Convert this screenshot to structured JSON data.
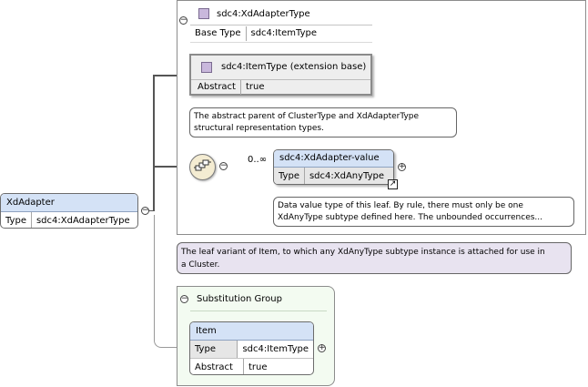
{
  "root": {
    "name": "XdAdapter",
    "type_label": "Type",
    "type_value": "sdc4:XdAdapterType"
  },
  "complex_type": {
    "name": "sdc4:XdAdapterType",
    "base_label": "Base Type",
    "base_value": "sdc4:ItemType"
  },
  "extension": {
    "name": "sdc4:ItemType (extension base)",
    "abstract_label": "Abstract",
    "abstract_value": "true"
  },
  "extension_note": [
    "The abstract parent of ClusterType and XdAdapterType",
    "structural representation types."
  ],
  "sequence": {
    "cardinality": "0..∞"
  },
  "child": {
    "name": "sdc4:XdAdapter-value",
    "type_label": "Type",
    "type_value": "sdc4:XdAnyType"
  },
  "child_note": [
    "Data value type of this leaf. By rule, there must only be one",
    "XdAnyType subtype defined here. The unbounded occurrences..."
  ],
  "root_note": [
    "The leaf variant of Item, to which any XdAnyType subtype instance is attached for use in",
    "a Cluster."
  ],
  "substitution": {
    "title": "Substitution Group",
    "item_name": "Item",
    "type_label": "Type",
    "type_value": "sdc4:ItemType",
    "abstract_label": "Abstract",
    "abstract_value": "true"
  },
  "colors": {
    "element_header": "#d4e2f6",
    "type_swatch": "#c9b8dc",
    "note_purple": "#e8e3f0",
    "substitution_bg": "#f3fbf1"
  }
}
